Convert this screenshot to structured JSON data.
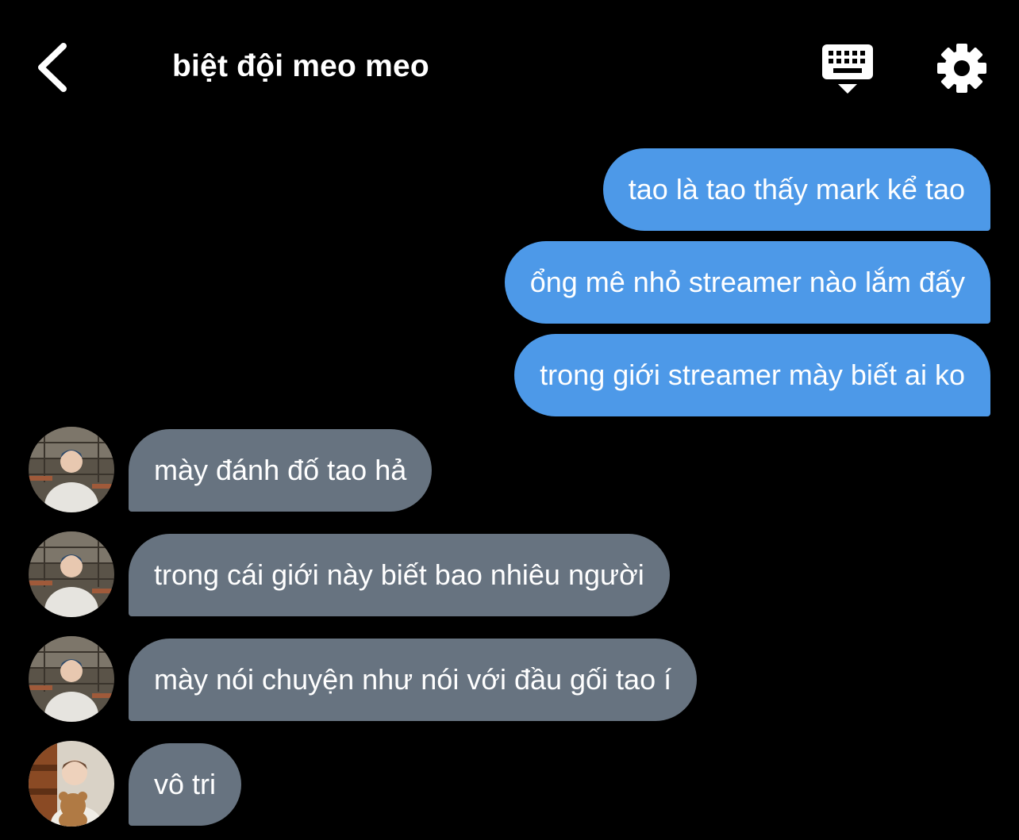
{
  "header": {
    "title": "biệt đội meo meo",
    "back_icon": "chevron-left-icon",
    "keyboard_icon": "keyboard-icon",
    "settings_icon": "gear-icon"
  },
  "colors": {
    "background": "#000000",
    "outgoing_bubble": "#4d99e8",
    "incoming_bubble": "#677380",
    "text": "#ffffff"
  },
  "messages": [
    {
      "direction": "out",
      "text": "tao là tao thấy mark kể tao"
    },
    {
      "direction": "out",
      "text": "ổng mê nhỏ streamer nào lắm đấy"
    },
    {
      "direction": "out",
      "text": "trong giới streamer mày biết ai ko"
    },
    {
      "direction": "in",
      "sender_avatar": "avatar-white-hoodie",
      "text": "mày đánh đố tao hả"
    },
    {
      "direction": "in",
      "sender_avatar": "avatar-white-hoodie",
      "text": "trong cái giới này biết bao nhiêu người"
    },
    {
      "direction": "in",
      "sender_avatar": "avatar-white-hoodie",
      "text": "mày nói chuyện như nói với đầu gối tao í"
    },
    {
      "direction": "in",
      "sender_avatar": "avatar-teddy-bear",
      "text": "vô tri"
    }
  ]
}
